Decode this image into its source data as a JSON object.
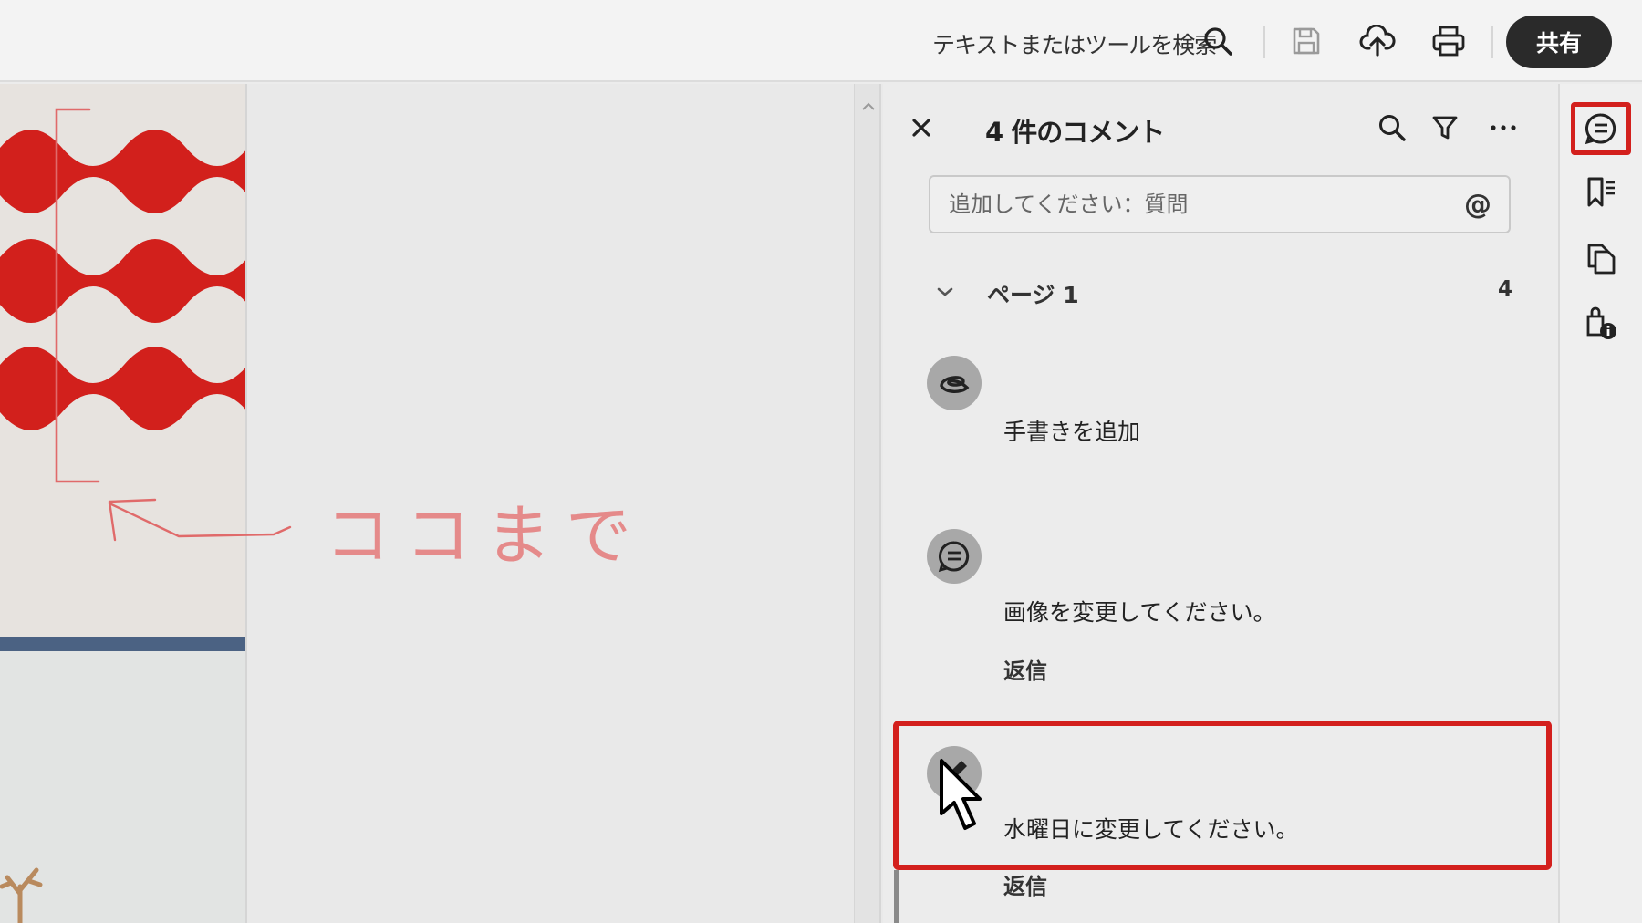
{
  "toolbar": {
    "search_label": "テキストまたはツールを検索",
    "share_label": "共有",
    "icons": [
      "search-icon",
      "save-icon",
      "upload-icon",
      "print-icon"
    ]
  },
  "document": {
    "handwriting_text": "ココまで",
    "colors": {
      "wave": "#d2201c",
      "ink": "#e06a6a",
      "band": "#4b6283"
    }
  },
  "comments_panel": {
    "title": "4 件のコメント",
    "input_placeholder": "追加してください：質問",
    "mention_label": "@",
    "group": {
      "label": "ページ 1",
      "count": "4"
    },
    "items": [
      {
        "type": "freehand",
        "icon": "freehand-icon",
        "text": "手書きを追加",
        "reply": ""
      },
      {
        "type": "note",
        "icon": "note-comment-icon",
        "text": "画像を変更してください。",
        "reply": "返信"
      },
      {
        "type": "edit",
        "icon": "pencil-icon",
        "text": "水曜日に変更してください。",
        "reply": "返信"
      }
    ]
  },
  "rail": {
    "icons": [
      "comments-icon",
      "bookmarks-icon",
      "pages-icon",
      "document-properties-icon"
    ],
    "active": "comments-icon"
  },
  "accent_color": "#d3201d"
}
